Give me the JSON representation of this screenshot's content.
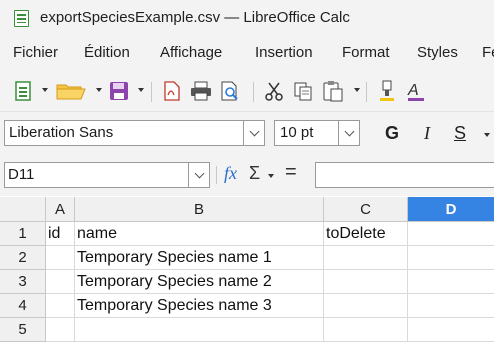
{
  "window": {
    "title": "exportSpeciesExample.csv — LibreOffice Calc"
  },
  "menu": [
    "Fichier",
    "Édition",
    "Affichage",
    "Insertion",
    "Format",
    "Styles",
    "Fe"
  ],
  "toolbar2": {
    "font_name": "Liberation Sans",
    "font_size": "10 pt",
    "bold": "G",
    "italic": "I",
    "underline": "S"
  },
  "formula_bar": {
    "name_box": "D11",
    "fx": "fx",
    "sum": "Σ",
    "equals": "="
  },
  "sheet": {
    "columns": [
      "A",
      "B",
      "C",
      "D"
    ],
    "selected_column": "D",
    "rows": [
      "1",
      "2",
      "3",
      "4",
      "5"
    ],
    "cells": [
      [
        "id",
        "name",
        "toDelete",
        ""
      ],
      [
        "",
        "Temporary Species name 1",
        "",
        ""
      ],
      [
        "",
        "Temporary Species name 2",
        "",
        ""
      ],
      [
        "",
        "Temporary Species name 3",
        "",
        ""
      ],
      [
        "",
        "",
        "",
        ""
      ]
    ]
  },
  "colors": {
    "selected_header": "#3584e4",
    "calc_green": "#3a8f3a"
  }
}
